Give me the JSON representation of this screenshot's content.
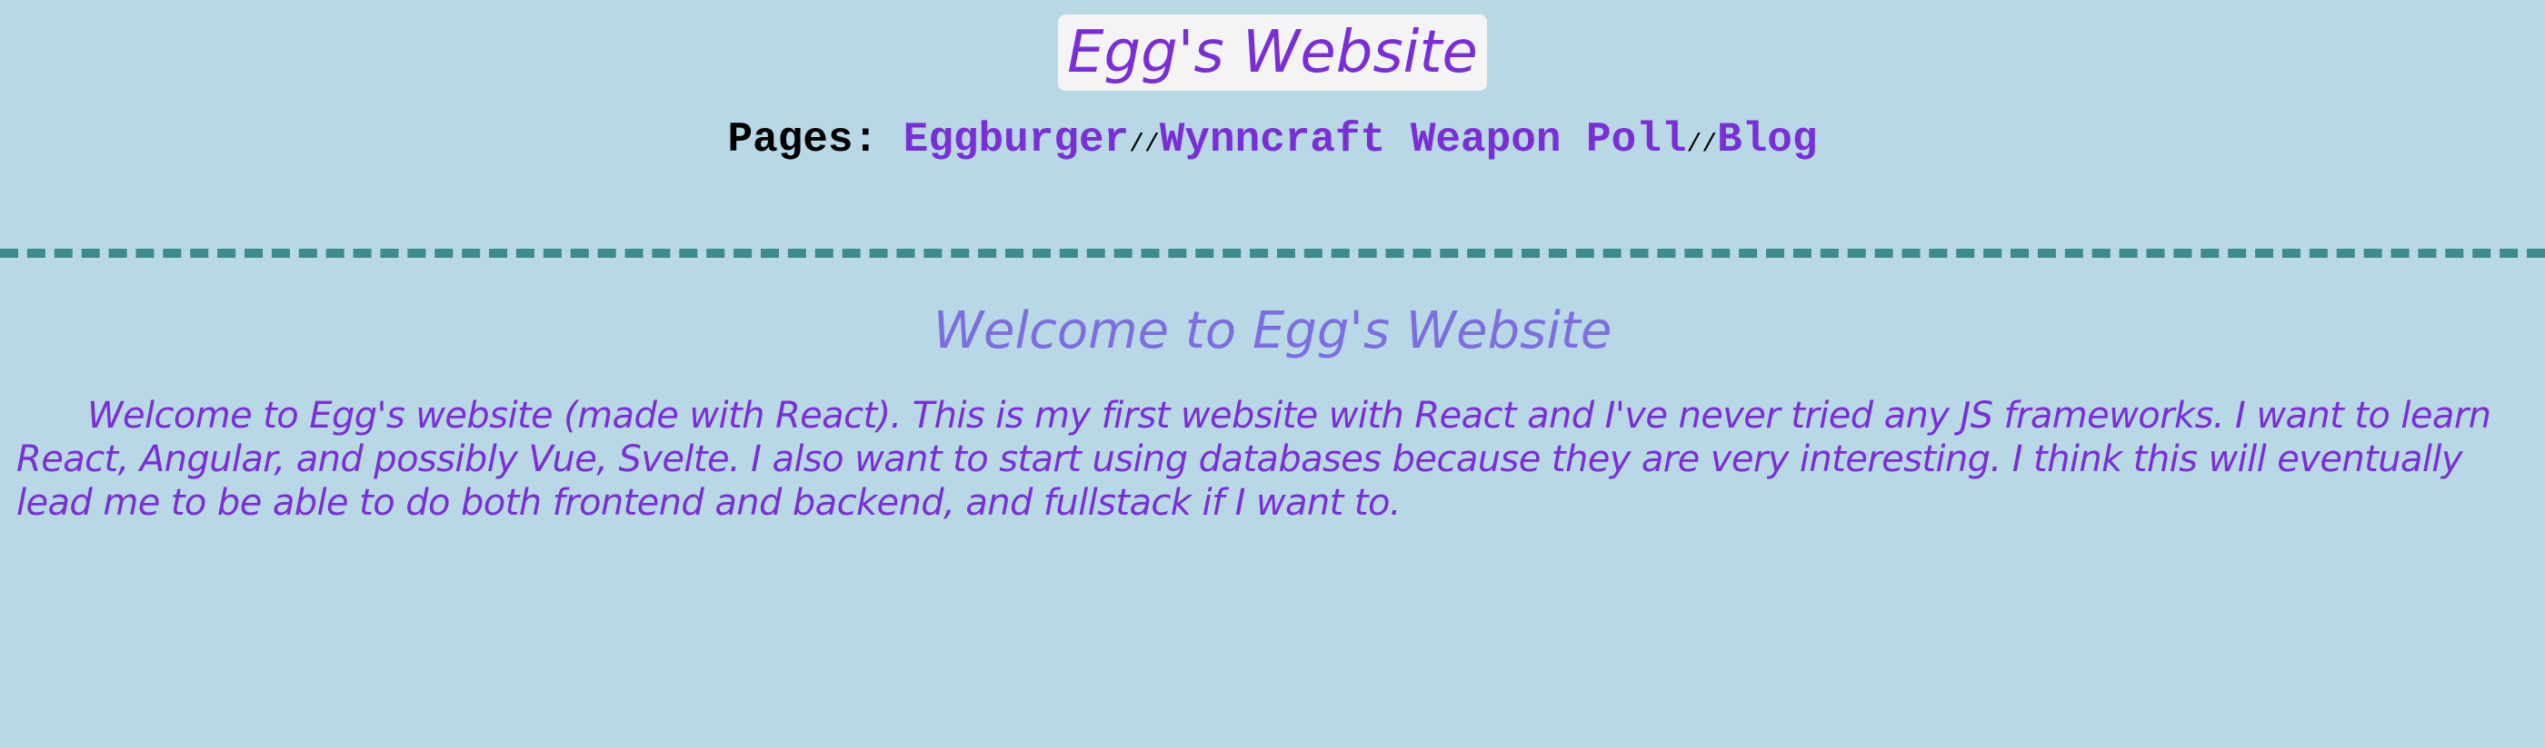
{
  "header": {
    "title": "Egg's Website",
    "pages_label": "Pages:",
    "nav_links": [
      {
        "label": "Eggburger"
      },
      {
        "label": "Wynncraft Weapon Poll"
      },
      {
        "label": "Blog"
      }
    ],
    "separator": "//"
  },
  "main": {
    "heading": "Welcome to Egg's Website",
    "paragraph": "Welcome to Egg's website (made with React). This is my first website with React and I've never tried any JS frameworks. I want to learn React, Angular, and possibly Vue, Svelte. I also want to start using databases because they are very interesting. I think this will eventually lead me to be able to do both frontend and backend, and fullstack if I want to."
  },
  "colors": {
    "background": "#b7d8e4",
    "accent": "#7a2fd6",
    "heading": "#7d6ee0",
    "divider": "#3e8b8e",
    "title_bg": "#f4f4f4"
  }
}
